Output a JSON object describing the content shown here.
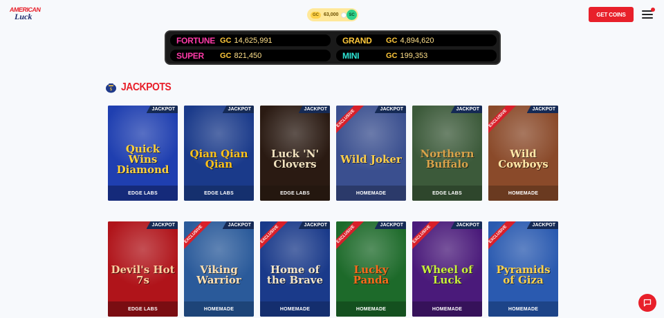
{
  "header": {
    "logo_line1": "AMERICAN",
    "logo_line2": "Luck",
    "gc_label": "GC",
    "gc_balance": "63,000",
    "sc_label": "SC",
    "get_coins": "GET COINS"
  },
  "jackpot_board": [
    {
      "name": "FORTUNE",
      "currency": "GC",
      "amount": "14,625,991",
      "color": "#ff3aa8"
    },
    {
      "name": "GRAND",
      "currency": "GC",
      "amount": "4,894,620",
      "color": "#ffc83a"
    },
    {
      "name": "SUPER",
      "currency": "GC",
      "amount": "821,450",
      "color": "#ff3aa8"
    },
    {
      "name": "MINI",
      "currency": "GC",
      "amount": "199,353",
      "color": "#2ee6d6"
    }
  ],
  "section": {
    "title": "JACKPOTS"
  },
  "labels": {
    "jackpot": "JACKPOT",
    "exclusive": "EXCLUSIVE"
  },
  "games": [
    {
      "title": "Quick Wins Diamond",
      "studio": "EDGE LABS",
      "bg": "#1f3fb0",
      "accent": "#ffd23a",
      "footer": "#152a7a",
      "exclusive": false
    },
    {
      "title": "Qian Qian Qian",
      "studio": "EDGE LABS",
      "bg": "#1a3a8a",
      "accent": "#ffc21a",
      "footer": "#15306e",
      "exclusive": false
    },
    {
      "title": "Luck 'N' Clovers",
      "studio": "EDGE LABS",
      "bg": "#2a1a12",
      "accent": "#f2e3c0",
      "footer": "#24170f",
      "exclusive": false
    },
    {
      "title": "Wild Joker",
      "studio": "HOMEMADE",
      "bg": "#3a4f8f",
      "accent": "#ffcf4a",
      "footer": "#2b3a6a",
      "exclusive": true
    },
    {
      "title": "Northern Buffalo",
      "studio": "EDGE LABS",
      "bg": "#3c5a3a",
      "accent": "#d8a24a",
      "footer": "#2e462c",
      "exclusive": false
    },
    {
      "title": "Wild Cowboys",
      "studio": "HOMEMADE",
      "bg": "#8a4a2a",
      "accent": "#ffe8a8",
      "footer": "#6a3a20",
      "exclusive": true
    },
    {
      "title": "Devil's Hot 7s",
      "studio": "EDGE LABS",
      "bg": "#b0141a",
      "accent": "#ffd0a0",
      "footer": "#7a0d12",
      "exclusive": false
    },
    {
      "title": "Viking Warrior",
      "studio": "HOMEMADE",
      "bg": "#2a5a9a",
      "accent": "#ffe0b0",
      "footer": "#1d4478",
      "exclusive": true
    },
    {
      "title": "Home of the Brave",
      "studio": "HOMEMADE",
      "bg": "#1a3a8a",
      "accent": "#f4e6c8",
      "footer": "#142e6e",
      "exclusive": true
    },
    {
      "title": "Lucky Panda",
      "studio": "HOMEMADE",
      "bg": "#1d6a2a",
      "accent": "#ff6a1a",
      "footer": "#14501f",
      "exclusive": true
    },
    {
      "title": "Wheel of Luck",
      "studio": "HOMEMADE",
      "bg": "#4a1a7a",
      "accent": "#c8f03a",
      "footer": "#36125a",
      "exclusive": true
    },
    {
      "title": "Pyramids of Giza",
      "studio": "HOMEMADE",
      "bg": "#2a5ab0",
      "accent": "#ffd24a",
      "footer": "#1d4488",
      "exclusive": true
    }
  ]
}
